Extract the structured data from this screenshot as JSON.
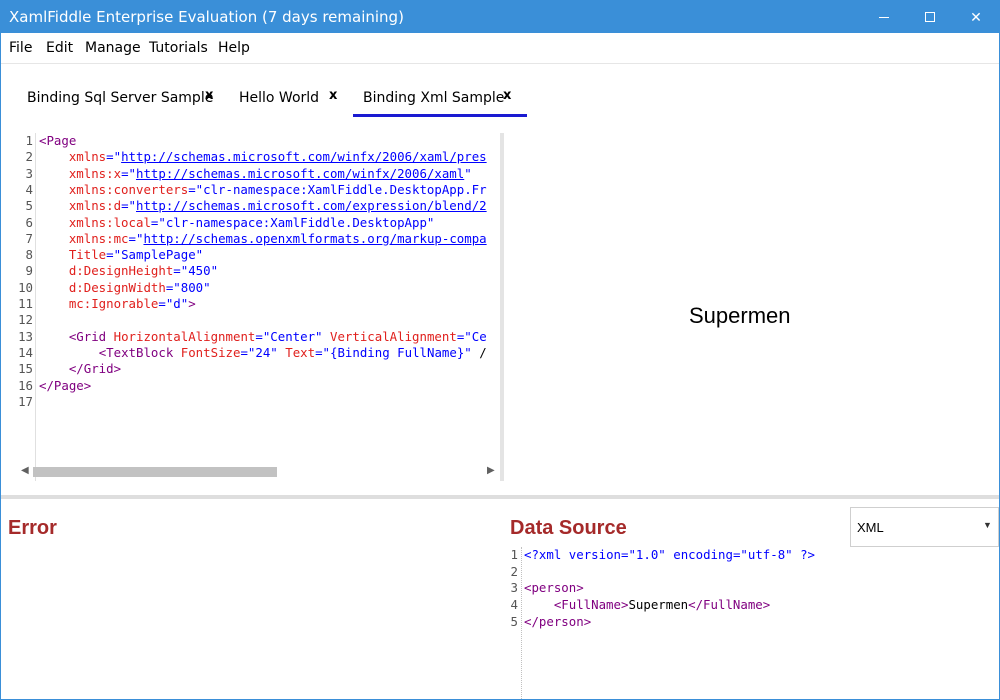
{
  "window": {
    "title": "XamlFiddle Enterprise Evaluation (7 days remaining)",
    "accent_color": "#3a8fd8"
  },
  "window_controls": {
    "minimize_icon": "minimize-icon",
    "maximize_icon": "maximize-icon",
    "close_icon": "close-icon",
    "close_glyph": "✕"
  },
  "menu": {
    "items": [
      "File",
      "Edit",
      "Manage",
      "Tutorials",
      "Help"
    ]
  },
  "tabs": [
    {
      "label": "Binding Sql Server Sample",
      "close": "x",
      "active": false
    },
    {
      "label": "Hello World",
      "close": "x",
      "active": false
    },
    {
      "label": "Binding Xml Sample",
      "close": "x",
      "active": true
    }
  ],
  "editor": {
    "lines": [
      {
        "n": "1",
        "text": "<Page"
      },
      {
        "n": "2",
        "text": "    xmlns=\"http://schemas.microsoft.com/winfx/2006/xaml/pres"
      },
      {
        "n": "3",
        "text": "    xmlns:x=\"http://schemas.microsoft.com/winfx/2006/xaml\""
      },
      {
        "n": "4",
        "text": "    xmlns:converters=\"clr-namespace:XamlFiddle.DesktopApp.Fr"
      },
      {
        "n": "5",
        "text": "    xmlns:d=\"http://schemas.microsoft.com/expression/blend/2"
      },
      {
        "n": "6",
        "text": "    xmlns:local=\"clr-namespace:XamlFiddle.DesktopApp\""
      },
      {
        "n": "7",
        "text": "    xmlns:mc=\"http://schemas.openxmlformats.org/markup-compa"
      },
      {
        "n": "8",
        "text": "    Title=\"SamplePage\""
      },
      {
        "n": "9",
        "text": "    d:DesignHeight=\"450\""
      },
      {
        "n": "10",
        "text": "    d:DesignWidth=\"800\""
      },
      {
        "n": "11",
        "text": "    mc:Ignorable=\"d\">"
      },
      {
        "n": "12",
        "text": ""
      },
      {
        "n": "13",
        "text": "    <Grid HorizontalAlignment=\"Center\" VerticalAlignment=\"Ce"
      },
      {
        "n": "14",
        "text": "        <TextBlock FontSize=\"24\" Text=\"{Binding FullName}\" /"
      },
      {
        "n": "15",
        "text": "    </Grid>"
      },
      {
        "n": "16",
        "text": "</Page>"
      },
      {
        "n": "17",
        "text": ""
      }
    ]
  },
  "preview": {
    "text": "Supermen"
  },
  "error_pane": {
    "title": "Error"
  },
  "data_source": {
    "title": "Data Source",
    "format_selected": "XML",
    "lines": [
      {
        "n": "1",
        "text": "<?xml version=\"1.0\" encoding=\"utf-8\" ?>"
      },
      {
        "n": "2",
        "text": ""
      },
      {
        "n": "3",
        "text": "<person>"
      },
      {
        "n": "4",
        "text": "    <FullName>Supermen</FullName>"
      },
      {
        "n": "5",
        "text": "</person>"
      }
    ]
  }
}
